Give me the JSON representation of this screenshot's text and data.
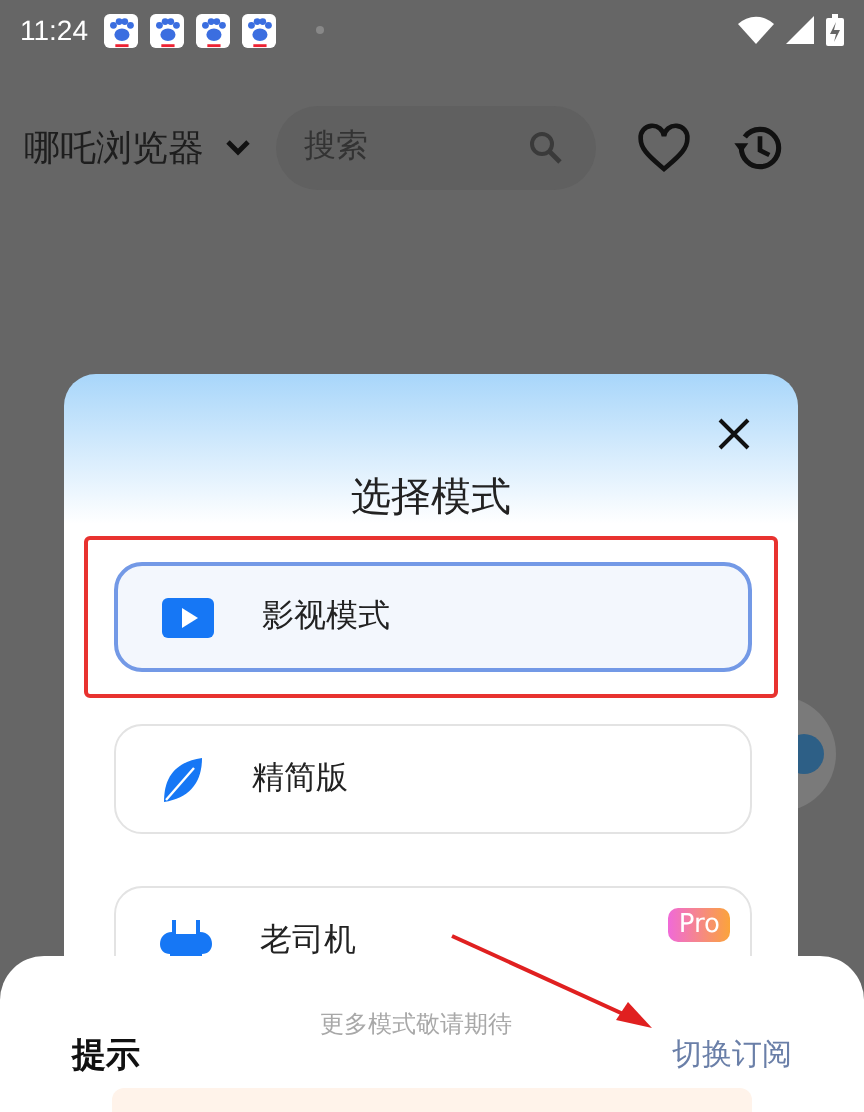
{
  "status_bar": {
    "time": "11:24"
  },
  "header": {
    "title": "哪吒浏览器",
    "search": {
      "placeholder": "搜索"
    }
  },
  "dialog": {
    "title": "选择模式",
    "options": [
      {
        "label": "影视模式",
        "kind": "video",
        "selected": true,
        "highlighted": true
      },
      {
        "label": "精简版",
        "kind": "leaf",
        "selected": false,
        "highlighted": false
      },
      {
        "label": "老司机",
        "kind": "outfit",
        "selected": false,
        "highlighted": false,
        "badge": "Pro"
      }
    ]
  },
  "sheet": {
    "faint_text": "更多模式敬请期待",
    "title": "提示",
    "action": "切换订阅"
  }
}
